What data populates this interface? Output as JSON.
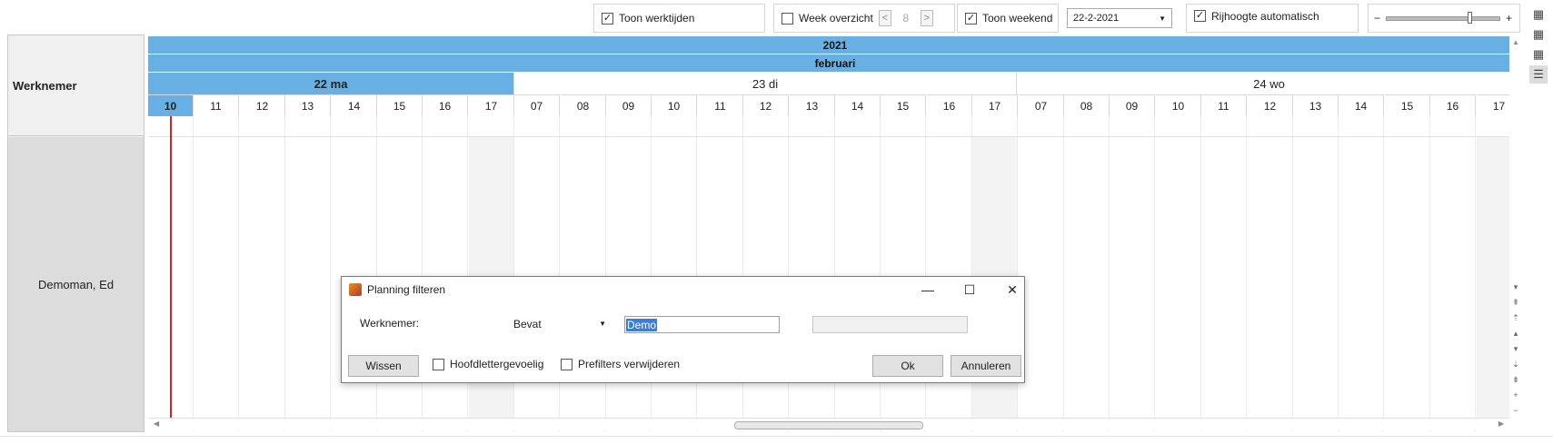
{
  "toolbar": {
    "show_worktimes": {
      "label": "Toon werktijden",
      "checked": true
    },
    "week_overview": {
      "label": "Week overzicht",
      "checked": false,
      "prev": "<",
      "week_number": "8",
      "next": ">"
    },
    "show_weekend": {
      "label": "Toon weekend",
      "checked": true
    },
    "date": {
      "value": "22-2-2021"
    },
    "row_height_auto": {
      "label": "Rijhoogte automatisch",
      "checked": true
    },
    "zoom": {
      "level": 0.75
    }
  },
  "grid": {
    "employee_header": "Werknemer",
    "year": "2021",
    "month": "februari",
    "days": [
      "22 ma",
      "23 di",
      "24 wo"
    ],
    "hours": [
      "10",
      "11",
      "12",
      "13",
      "14",
      "15",
      "16",
      "17",
      "07",
      "08",
      "09",
      "10",
      "11",
      "12",
      "13",
      "14",
      "15",
      "16",
      "17",
      "07",
      "08",
      "09",
      "10",
      "11",
      "12",
      "13",
      "14",
      "15",
      "16",
      "17"
    ],
    "current_hour_index": 0,
    "rows": [
      {
        "name": "Demoman, Ed"
      }
    ]
  },
  "dialog": {
    "title": "Planning filteren",
    "field_label": "Werknemer:",
    "operator": "Bevat",
    "value": "Demo",
    "clear_button": "Wissen",
    "case_sensitive": {
      "label": "Hoofdlettergevoelig",
      "checked": false
    },
    "remove_prefilters": {
      "label": "Prefilters verwijderen",
      "checked": false
    },
    "ok_button": "Ok",
    "cancel_button": "Annuleren"
  },
  "colors": {
    "accent": "#68b0e3",
    "now_line": "#e02020"
  }
}
